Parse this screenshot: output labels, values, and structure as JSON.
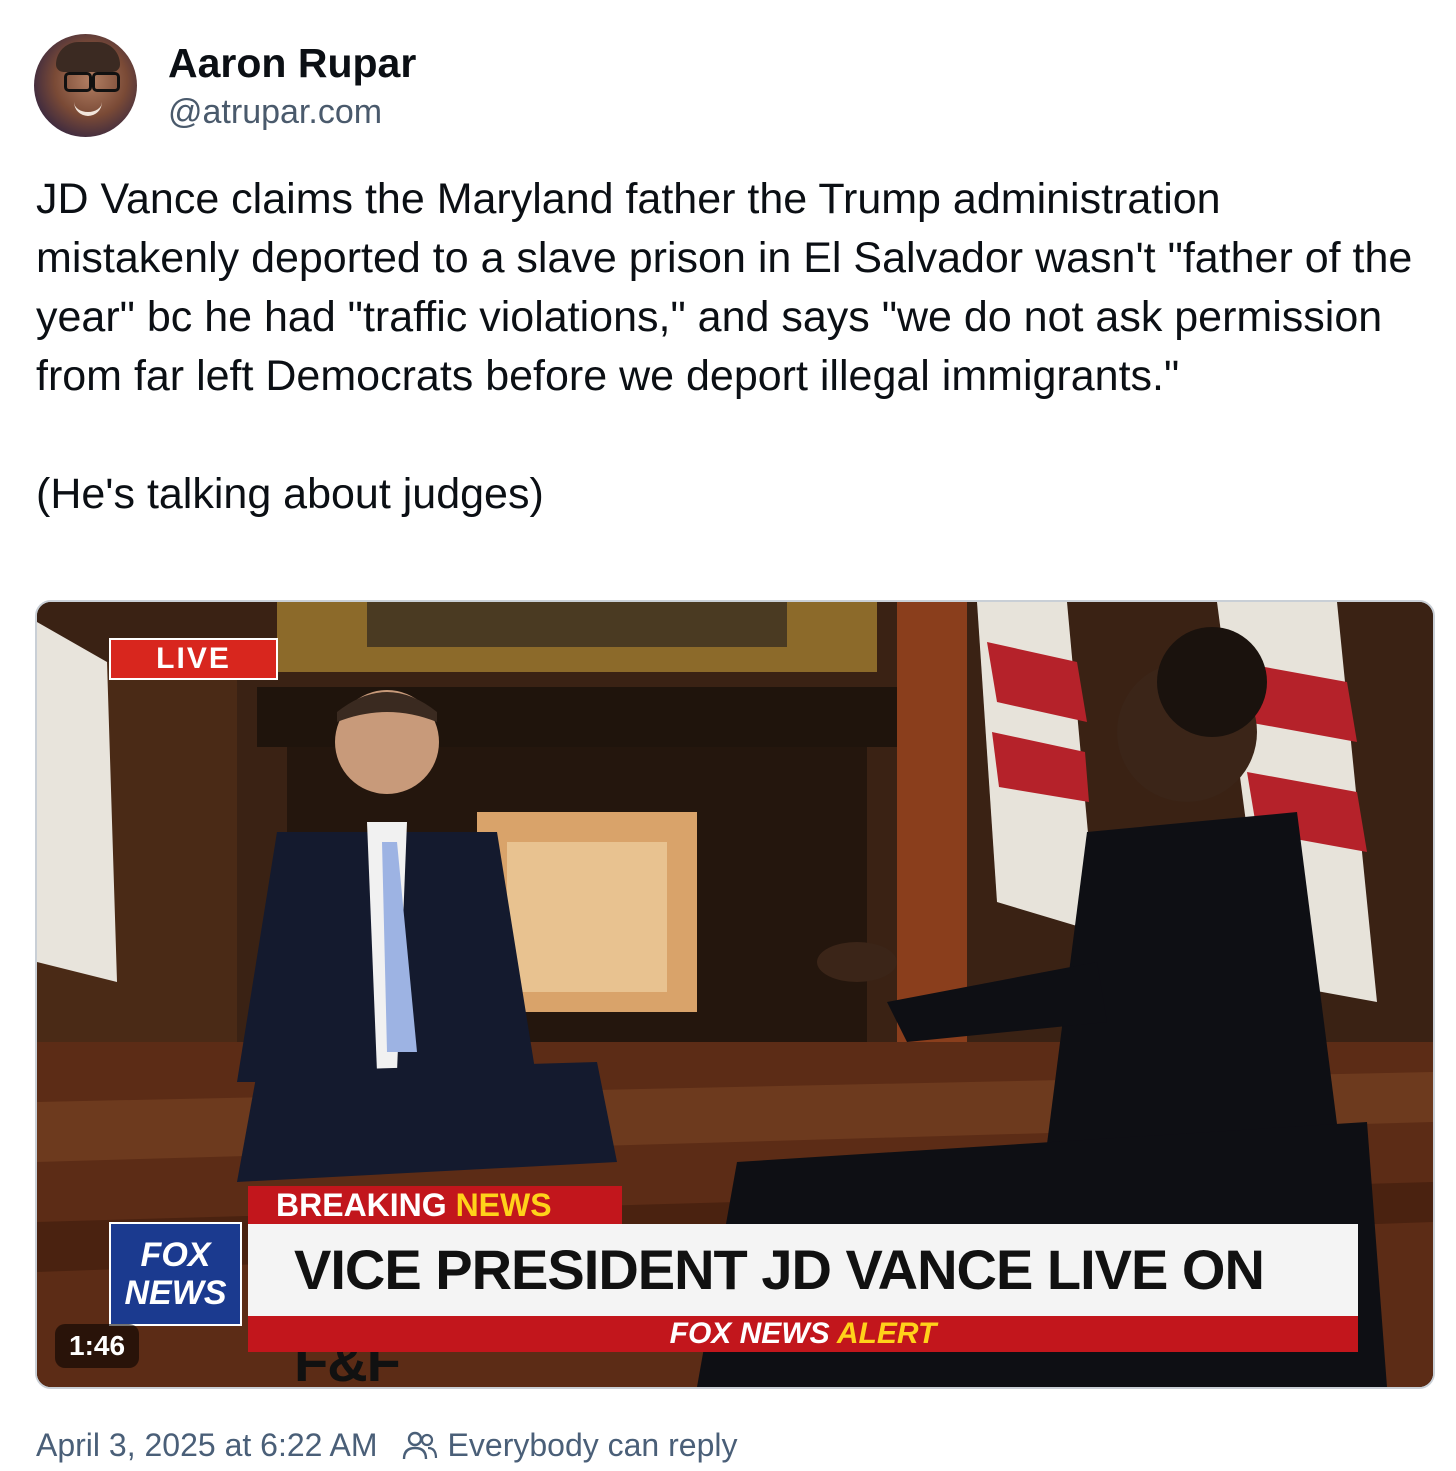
{
  "author": {
    "name": "Aaron Rupar",
    "handle": "@atrupar.com"
  },
  "post": {
    "text_paragraph_1": "JD Vance claims the Maryland father the Trump administration mistakenly deported to a slave prison in El Salvador wasn't \"father of the year\" bc he had \"traffic violations,\" and says \"we do not ask permission from far left Democrats before we deport illegal immigrants.\"",
    "text_paragraph_2": "(He's talking about judges)"
  },
  "video": {
    "live_label": "LIVE",
    "breaking_word_1": "BREAKING",
    "breaking_word_2": "NEWS",
    "headline": "VICE PRESIDENT JD VANCE LIVE ON F&F",
    "alert_prefix": "FOX NEWS",
    "alert_suffix": "ALERT",
    "logo_line_1": "FOX",
    "logo_line_2": "NEWS",
    "duration": "1:46"
  },
  "footer": {
    "timestamp": "April 3, 2025 at 6:22 AM",
    "reply_setting": "Everybody can reply",
    "reply_icon": "people-icon"
  },
  "colors": {
    "text_primary": "#0b0f14",
    "text_secondary": "#4a5f78",
    "fox_red": "#c2161c",
    "fox_blue": "#1b3a8f",
    "fox_yellow": "#ffd21a"
  }
}
